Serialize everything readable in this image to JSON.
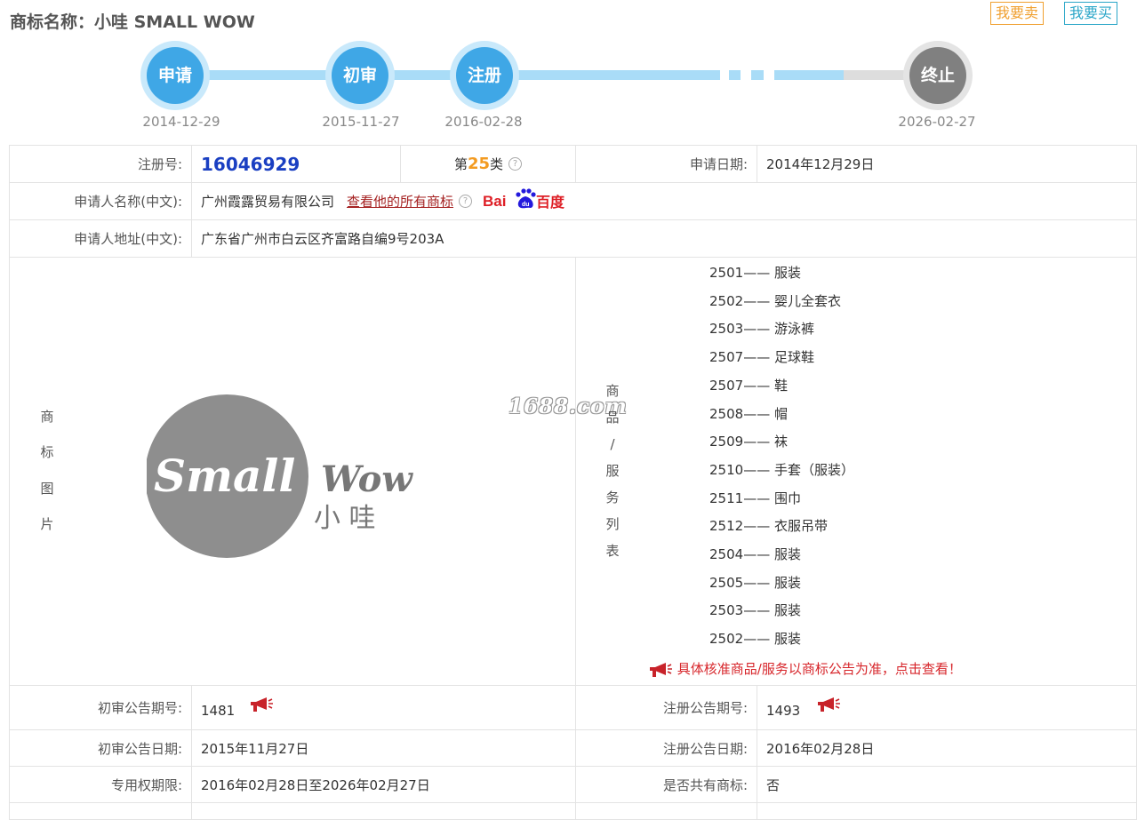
{
  "header": {
    "title": "商标名称：小哇 SMALL WOW",
    "sell_label": "我要卖",
    "buy_label": "我要买"
  },
  "timeline": [
    {
      "label": "申请",
      "date": "2014-12-29",
      "status": "done"
    },
    {
      "label": "初审",
      "date": "2015-11-27",
      "status": "done"
    },
    {
      "label": "注册",
      "date": "2016-02-28",
      "status": "done"
    },
    {
      "label": "终止",
      "date": "2026-02-27",
      "status": "pending"
    }
  ],
  "info": {
    "reg_no_label": "注册号:",
    "reg_no": "16046929",
    "class_prefix": "第",
    "class_num": "25",
    "class_suffix": "类",
    "apply_date_label": "申请日期:",
    "apply_date": "2014年12月29日",
    "applicant_label": "申请人名称(中文):",
    "applicant": "广州霞露贸易有限公司",
    "view_all_link": "查看他的所有商标",
    "baidu_text": "Bai百度",
    "address_label": "申请人地址(中文):",
    "address": "广东省广州市白云区齐富路自编9号203A",
    "image_label": [
      "商",
      "标",
      "图",
      "片"
    ],
    "logo_text": "Small Wow",
    "logo_sub": "小 哇",
    "watermark": "1688.com",
    "services_label": [
      "商",
      "品",
      "/",
      "服",
      "务",
      "列",
      "表"
    ],
    "services": [
      {
        "code": "2501",
        "name": "服装"
      },
      {
        "code": "2502",
        "name": "婴儿全套衣"
      },
      {
        "code": "2503",
        "name": "游泳裤"
      },
      {
        "code": "2507",
        "name": "足球鞋"
      },
      {
        "code": "2507",
        "name": "鞋"
      },
      {
        "code": "2508",
        "name": "帽"
      },
      {
        "code": "2509",
        "name": "袜"
      },
      {
        "code": "2510",
        "name": "手套（服装）"
      },
      {
        "code": "2511",
        "name": "围巾"
      },
      {
        "code": "2512",
        "name": "衣服吊带"
      },
      {
        "code": "2504",
        "name": "服装"
      },
      {
        "code": "2505",
        "name": "服装"
      },
      {
        "code": "2503",
        "name": "服装"
      },
      {
        "code": "2502",
        "name": "服装"
      }
    ],
    "services_notice": "具体核准商品/服务以商标公告为准，点击查看！",
    "prelim_no_label": "初审公告期号:",
    "prelim_no": "1481",
    "reg_pub_no_label": "注册公告期号:",
    "reg_pub_no": "1493",
    "prelim_date_label": "初审公告日期:",
    "prelim_date": "2015年11月27日",
    "reg_pub_date_label": "注册公告日期:",
    "reg_pub_date": "2016年02月28日",
    "term_label": "专用权期限:",
    "term": "2016年02月28日至2026年02月27日",
    "shared_label": "是否共有商标:",
    "shared": "否"
  },
  "colors": {
    "step_active": "#3fa7e6",
    "step_end": "#808080",
    "reg_no": "#1a3fc2",
    "class_num": "#f39b21",
    "link": "#a52121",
    "notice": "#d7262b"
  }
}
